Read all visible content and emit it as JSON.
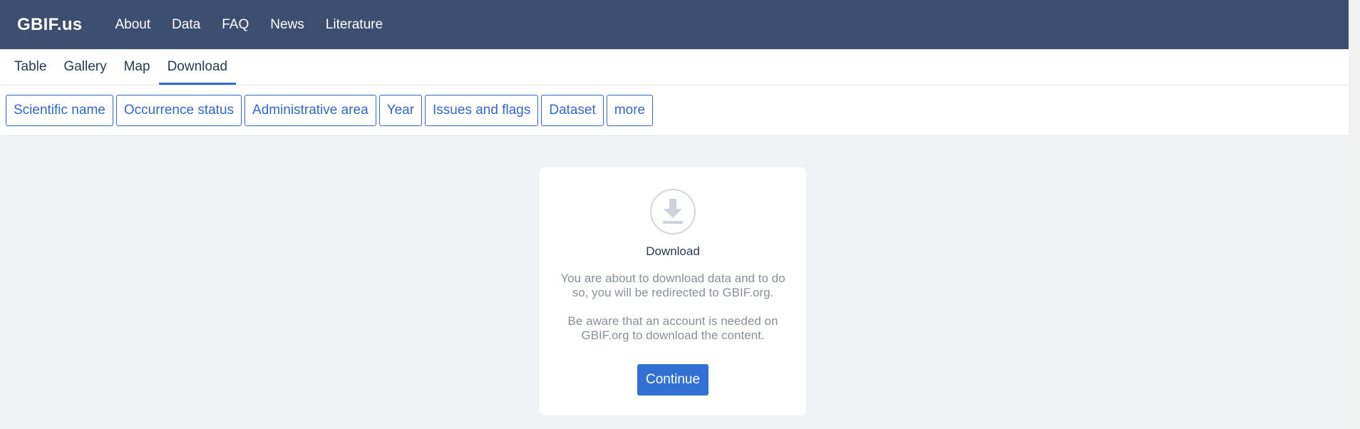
{
  "brand": "GBIF.us",
  "nav": [
    "About",
    "Data",
    "FAQ",
    "News",
    "Literature"
  ],
  "tabs": [
    {
      "label": "Table",
      "active": false
    },
    {
      "label": "Gallery",
      "active": false
    },
    {
      "label": "Map",
      "active": false
    },
    {
      "label": "Download",
      "active": true
    }
  ],
  "filters": [
    "Scientific name",
    "Occurrence status",
    "Administrative area",
    "Year",
    "Issues and flags",
    "Dataset",
    "more"
  ],
  "card": {
    "icon": "download-icon",
    "title": "Download",
    "text1": "You are about to download data and to do so, you will be redirected to GBIF.org.",
    "text2": "Be aware that an account is needed on GBIF.org to download the content.",
    "button": "Continue"
  },
  "colors": {
    "header": "#3d4f6f",
    "accent": "#3370d4",
    "background": "#f0f3f5"
  }
}
